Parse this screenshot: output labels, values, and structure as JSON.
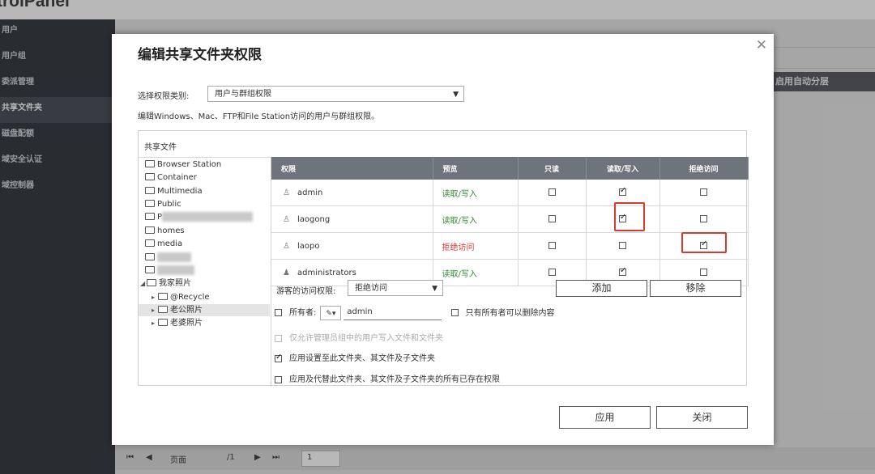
{
  "background": {
    "app_title_partial": "trolPanel",
    "sidebar": [
      "用户",
      "用户组",
      "委派管理",
      "共享文件夹",
      "磁盘配额",
      "域安全认证",
      "域控制器"
    ],
    "active_sidebar_index": 3,
    "table_header_partial": "启用自动分层",
    "pagination": {
      "prefix": "页面",
      "value": "1",
      "suffix": "/1"
    }
  },
  "dialog": {
    "title": "编辑共享文件夹权限",
    "category_label": "选择权限类别:",
    "category_value": "用户与群组权限",
    "description": "编辑Windows、Mac、FTP和File Station访问的用户与群组权限。",
    "panel_header": "共享文件",
    "tree": [
      {
        "label": "Browser Station"
      },
      {
        "label": "Container"
      },
      {
        "label": "Multimedia"
      },
      {
        "label": "Public"
      },
      {
        "label": "P"
      },
      {
        "label": "homes"
      },
      {
        "label": "media"
      },
      {
        "label": ""
      },
      {
        "label": ""
      },
      {
        "label": "我家照片"
      },
      {
        "label": "@Recycle"
      },
      {
        "label": "老公照片"
      },
      {
        "label": "老婆照片"
      }
    ],
    "table_headers": [
      "权限",
      "预览",
      "只读",
      "读取/写入",
      "拒绝访问"
    ],
    "rows": [
      {
        "name": "admin",
        "preview": "读取/写入",
        "preview_color": "#2e8b2e",
        "read_only": false,
        "read_write": true,
        "deny": false
      },
      {
        "name": "laogong",
        "preview": "读取/写入",
        "preview_color": "#2e8b2e",
        "read_only": false,
        "read_write": true,
        "deny": false
      },
      {
        "name": "laopo",
        "preview": "拒绝访问",
        "preview_color": "#d9342b",
        "read_only": false,
        "read_write": false,
        "deny": true
      },
      {
        "name": "administrators",
        "preview": "读取/写入",
        "preview_color": "#2e8b2e",
        "read_only": false,
        "read_write": true,
        "deny": false
      }
    ],
    "guest_label": "游客的访问权限:",
    "guest_value": "拒绝访问",
    "add_label": "添加",
    "remove_label": "移除",
    "owner_label": "所有者:",
    "owner_value": "admin",
    "owner_only_delete": "只有所有者可以删除内容",
    "admin_only_write": "仅允许管理员组中的用户写入文件和文件夹",
    "apply_sub": "应用设置至此文件夹、其文件及子文件夹",
    "apply_replace": "应用及代替此文件夹、其文件及子文件夹的所有已存在权限",
    "apply_label": "应用",
    "close_label": "关闭"
  }
}
